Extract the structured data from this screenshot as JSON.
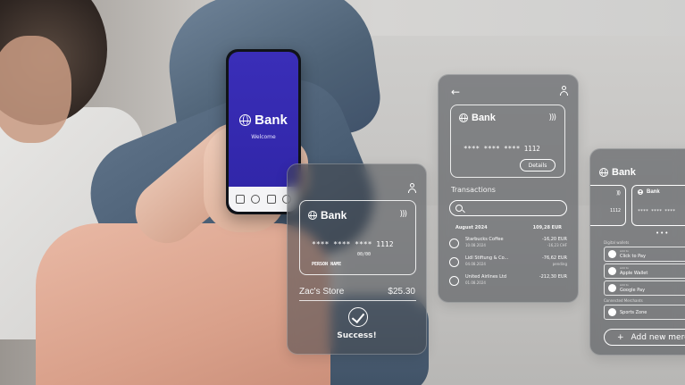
{
  "phone": {
    "brand": "Bank",
    "welcome": "Welcome",
    "tabbar_icons": [
      "home-icon",
      "chat-icon",
      "list-icon",
      "profile-icon"
    ]
  },
  "payment_panel": {
    "brand": "Bank",
    "card_number": "**** **** **** 1112",
    "card_expiry": "00/00",
    "card_holder": "PERSON NAME",
    "store": "Zac's Store",
    "amount": "$25.30",
    "status": "Success!"
  },
  "transactions_panel": {
    "brand": "Bank",
    "card_number": "**** **** **** 1112",
    "details_button": "Details",
    "heading": "Transactions",
    "month": "August 2024",
    "month_total": "109,28 EUR",
    "items": [
      {
        "name": "Starbucks Coffee",
        "date": "10.08.2024",
        "amount": "-16,20 EUR",
        "sub": "-16,23 CHF"
      },
      {
        "name": "Lidl Stiftung & Co...",
        "date": "04.08.2024",
        "amount": "-76,62 EUR",
        "sub": "pending"
      },
      {
        "name": "United Airlines Ltd",
        "date": "01.08.2024",
        "amount": "-212,30 EUR",
        "sub": ""
      }
    ]
  },
  "wallet_panel": {
    "brand": "Bank",
    "mini_card_left_number": "1112",
    "mini_card_right_brand": "Bank",
    "mini_card_right_number": "**** **** ****",
    "section_wallets": "Digital wallets",
    "wallets": [
      {
        "top": "Add to",
        "label": "Click to Pay",
        "icon": "click-to-pay-icon"
      },
      {
        "top": "Add to",
        "label": "Apple Wallet",
        "icon": "apple-icon"
      },
      {
        "top": "Add to",
        "label": "Google Pay",
        "icon": "google-icon"
      }
    ],
    "section_merchants": "Connected Merchants",
    "merchant": "Sports Zone",
    "add_button": "Add new merch"
  },
  "colors": {
    "phone_screen": "#3a2eb8",
    "glass": "#46484e",
    "text": "#ffffff"
  }
}
